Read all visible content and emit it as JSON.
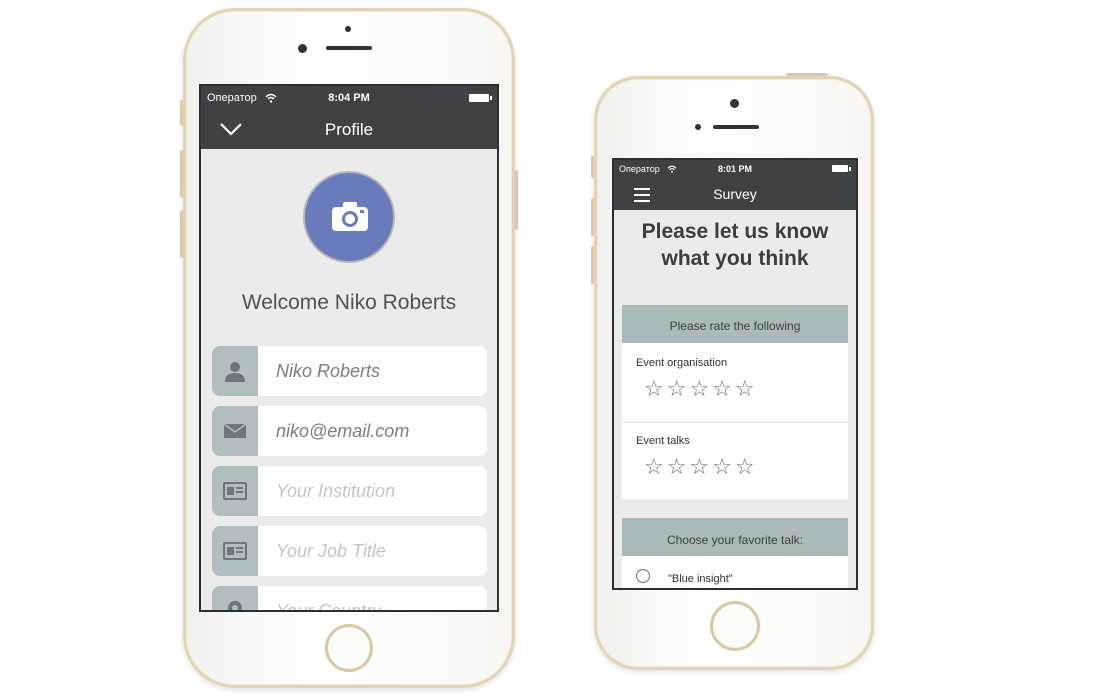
{
  "profile_screen": {
    "status": {
      "carrier": "Оператор",
      "time": "8:04 PM"
    },
    "nav": {
      "title": "Profile"
    },
    "welcome": "Welcome Niko Roberts",
    "fields": [
      {
        "value": "Niko Roberts",
        "placeholder": "",
        "icon": "person-icon"
      },
      {
        "value": "niko@email.com",
        "placeholder": "",
        "icon": "mail-icon"
      },
      {
        "value": "",
        "placeholder": "Your Institution",
        "icon": "id-card-icon"
      },
      {
        "value": "",
        "placeholder": "Your Job Title",
        "icon": "id-card-icon"
      },
      {
        "value": "",
        "placeholder": "Your Country",
        "icon": "location-icon"
      }
    ],
    "avatar_color": "#6a7bbb",
    "nav_color": "#3e4244"
  },
  "survey_screen": {
    "status": {
      "carrier": "Оператор",
      "time": "8:01 PM"
    },
    "nav": {
      "title": "Survey"
    },
    "headline_line1": "Please let us know",
    "headline_line2": "what you think",
    "rating_section": {
      "header": "Please rate the following",
      "items": [
        {
          "label": "Event organisation",
          "stars": "☆☆☆☆☆",
          "rating": 0
        },
        {
          "label": "Event talks",
          "stars": "☆☆☆☆☆",
          "rating": 0
        }
      ]
    },
    "talk_section": {
      "header": "Choose your favorite talk:",
      "options": [
        {
          "label": "\"Blue insight\"",
          "selected": false
        }
      ]
    },
    "section_header_color": "#aab9b9"
  }
}
